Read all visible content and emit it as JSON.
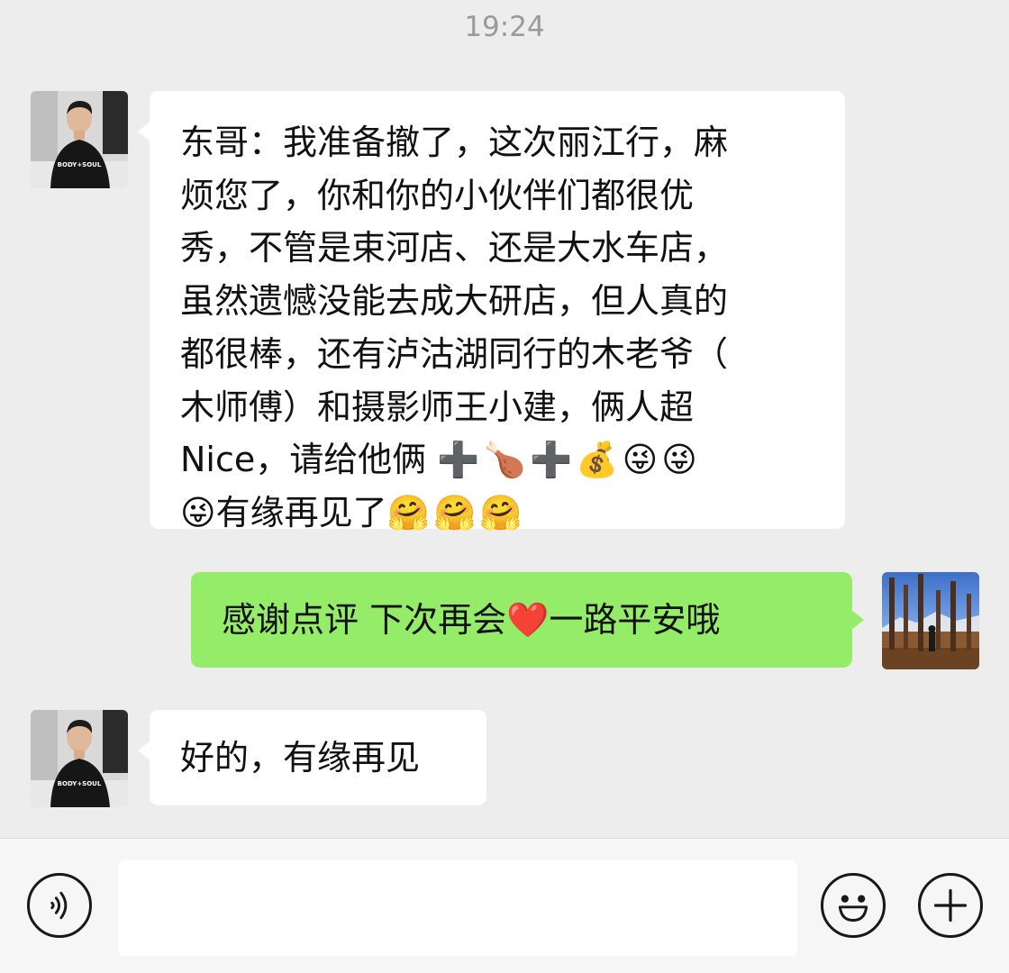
{
  "header": {
    "timestamp": "19:24"
  },
  "messages": [
    {
      "sender": "contact",
      "avatar_icon": "avatar-man-icon",
      "shirt_text": "BODY+SOUL",
      "lines": [
        "东哥：我准备撤了，这次丽江行，麻",
        "烦您了，你和你的小伙伴们都很优",
        "秀，不管是束河店、还是大水车店，",
        "虽然遗憾没能去成大研店，但人真的",
        "都很棒，还有泸沽湖同行的木老爷（",
        "木师傅）和摄影师王小建，俩人超"
      ],
      "line7_text": "Nice，请给他俩",
      "line7_emojis": "➕🍗➕💰😜😜",
      "line8_emoji_lead": "😜",
      "line8_text": "有缘再见了",
      "line8_emojis": "🤗🤗🤗"
    },
    {
      "sender": "me",
      "avatar_icon": "avatar-landscape-icon",
      "text_part1": "感谢点评 下次再会",
      "heart_emoji": "❤️",
      "text_part2": " 一路平安哦"
    },
    {
      "sender": "contact",
      "avatar_icon": "avatar-man-icon",
      "text": "好的，有缘再见"
    }
  ],
  "input_bar": {
    "voice_icon": "voice-icon",
    "input_value": "",
    "emoji_icon": "emoji-icon",
    "plus_icon": "plus-icon"
  },
  "colors": {
    "background": "#ededed",
    "incoming_bubble": "#ffffff",
    "outgoing_bubble": "#95ec69",
    "timestamp": "#9a9a9a"
  }
}
